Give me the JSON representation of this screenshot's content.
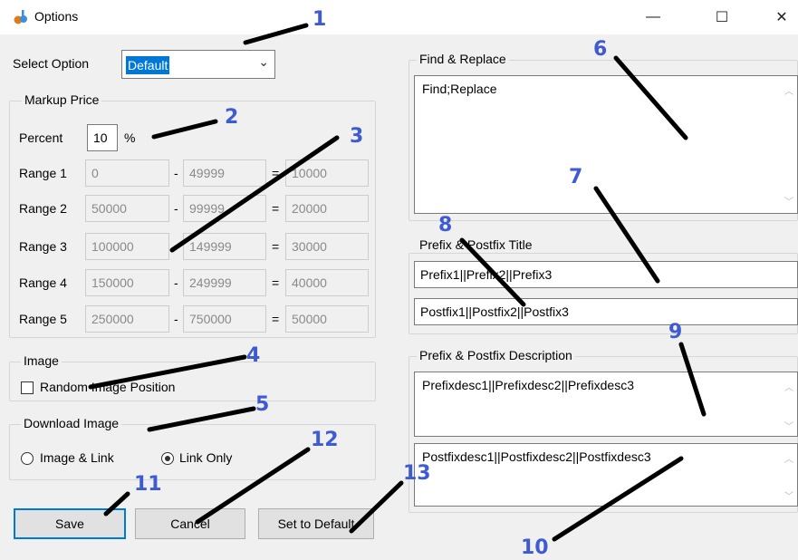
{
  "window": {
    "title": "Options",
    "controls": {
      "minimize": "—",
      "maximize": "☐",
      "close": "✕"
    }
  },
  "select_option": {
    "label": "Select Option",
    "value": "Default"
  },
  "markup_price": {
    "legend": "Markup Price",
    "percent_label": "Percent",
    "percent_value": "10",
    "percent_unit": "%",
    "ranges": [
      {
        "label": "Range 1",
        "from": "0",
        "to": "49999",
        "result": "10000"
      },
      {
        "label": "Range 2",
        "from": "50000",
        "to": "99999",
        "result": "20000"
      },
      {
        "label": "Range 3",
        "from": "100000",
        "to": "149999",
        "result": "30000"
      },
      {
        "label": "Range 4",
        "from": "150000",
        "to": "249999",
        "result": "40000"
      },
      {
        "label": "Range 5",
        "from": "250000",
        "to": "750000",
        "result": "50000"
      }
    ],
    "dash": "-",
    "equals": "="
  },
  "image": {
    "legend": "Image",
    "random_position_label": "Random Image Position",
    "random_position_checked": false
  },
  "download_image": {
    "legend": "Download Image",
    "options": [
      "Image & Link",
      "Link Only"
    ],
    "selected": "Link Only"
  },
  "buttons": {
    "save": "Save",
    "cancel": "Cancel",
    "set_default": "Set to Default"
  },
  "find_replace": {
    "legend": "Find & Replace",
    "text": "Find;Replace"
  },
  "prefix_postfix_title": {
    "legend": "Prefix & Postfix Title",
    "prefix": "Prefix1||Prefix2||Prefix3",
    "postfix": "Postfix1||Postfix2||Postfix3"
  },
  "prefix_postfix_description": {
    "legend": "Prefix & Postfix Description",
    "prefix": "Prefixdesc1||Prefixdesc2||Prefixdesc3",
    "postfix": "Postfixdesc1||Postfixdesc2||Postfixdesc3"
  },
  "annotations": [
    "1",
    "2",
    "3",
    "4",
    "5",
    "6",
    "7",
    "8",
    "9",
    "10",
    "11",
    "12",
    "13"
  ],
  "colors": {
    "annotation": "#3f5bd1",
    "accent": "#0078d7",
    "arrow": "#000000"
  }
}
